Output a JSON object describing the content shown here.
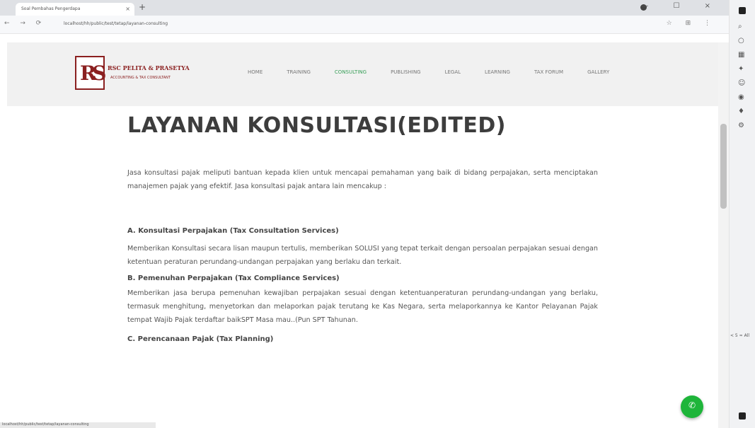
{
  "browser": {
    "tab_title": "Soal Pembahas Pengerdapa",
    "tab_close": "×",
    "new_tab": "+",
    "nav_buttons": "← → ⟳",
    "url": "localhost/hh/public/test/tetap/layanan-consulting",
    "url_tools": "☆ ⊞ ⋮",
    "window_controls": "— ☐ ×"
  },
  "site": {
    "logo_mark": "RS",
    "logo_name": "RSC PELITA & PRASETYA",
    "logo_tagline": "ACCOUNTING & TAX CONSULTANT",
    "nav": [
      {
        "label": "HOME"
      },
      {
        "label": "TRAINING"
      },
      {
        "label": "CONSULTING"
      },
      {
        "label": "PUBLISHING"
      },
      {
        "label": "LEGAL"
      },
      {
        "label": "LEARNING"
      },
      {
        "label": "TAX FORUM"
      },
      {
        "label": "GALLERY"
      }
    ],
    "active_nav": "CONSULTING"
  },
  "content": {
    "title": "LAYANAN KONSULTASI(EDITED)",
    "intro": "Jasa konsultasi pajak meliputi bantuan kepada klien untuk mencapai pemahaman yang baik di bidang perpajakan, serta menciptakan manajemen pajak yang efektif. Jasa konsultasi pajak antara lain mencakup :",
    "sections": [
      {
        "heading": "A. Konsultasi Perpajakan (Tax Consultation Services)",
        "body": "Memberikan Konsultasi secara lisan maupun tertulis, memberikan SOLUSI yang tepat terkait dengan persoalan perpajakan sesuai dengan ketentuan peraturan perundang-undangan perpajakan yang berlaku dan terkait."
      },
      {
        "heading": "B. Pemenuhan Perpajakan (Tax Compliance Services)",
        "body": "Memberikan jasa berupa pemenuhan kewajiban perpajakan sesuai dengan ketentuanperaturan perundang-undangan yang berlaku, termasuk menghitung, menyetorkan dan melaporkan pajak terutang ke Kas Negara, serta melaporkannya ke Kantor Pelayanan Pajak tempat Wajib Pajak terdaftar baikSPT Masa mau..(Pun SPT Tahunan."
      },
      {
        "heading": "C. Perencanaan Pajak (Tax Planning)",
        "body": ""
      }
    ]
  },
  "status_bar_text": "localhost/hh/public/test/tetap/layanan-consulting",
  "side_panel_notes": "< 5 ≈ All",
  "colors": {
    "brand": "#8b2020",
    "nav_active": "#3aa05a",
    "fab": "#1eb53a"
  }
}
